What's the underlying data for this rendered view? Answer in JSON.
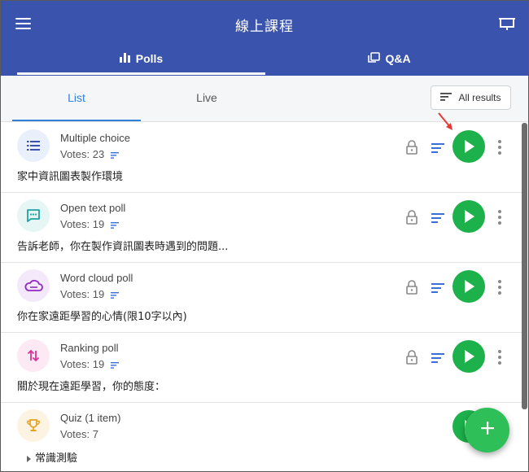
{
  "header": {
    "title": "線上課程",
    "menu_icon": "hamburger-icon",
    "present_icon": "screen-icon"
  },
  "tabs": [
    {
      "label": "Polls",
      "icon": "bar-chart-icon",
      "active": true
    },
    {
      "label": "Q&A",
      "icon": "chat-bubbles-icon",
      "active": false
    }
  ],
  "subtabs": [
    {
      "label": "List",
      "active": true
    },
    {
      "label": "Live",
      "active": false
    }
  ],
  "results_button": {
    "label": "All results",
    "icon": "sort-lines-icon"
  },
  "polls": [
    {
      "type": "Multiple choice",
      "votes": "Votes: 23",
      "question": "家中資訊圖表製作環境",
      "icon": "list-icon",
      "color": "#3a54ad",
      "bg": "#eaf0fb"
    },
    {
      "type": "Open text poll",
      "votes": "Votes: 19",
      "question": "告訴老師，你在製作資訊圖表時遇到的問題...",
      "icon": "message-icon",
      "color": "#1ea3a3",
      "bg": "#e5f6f5"
    },
    {
      "type": "Word cloud poll",
      "votes": "Votes: 19",
      "question": "你在家遠距學習的心情(限10字以內)",
      "icon": "cloud-icon",
      "color": "#9326c4",
      "bg": "#f4e9fa"
    },
    {
      "type": "Ranking poll",
      "votes": "Votes: 19",
      "question": "關於現在遠距學習，你的態度：",
      "icon": "swap-arrows-icon",
      "color": "#d6339a",
      "bg": "#fce9f4"
    },
    {
      "type": "Quiz (1 item)",
      "votes": "Votes: 7",
      "question": "常識測驗",
      "icon": "trophy-icon",
      "color": "#e8a020",
      "bg": "#fdf3e3"
    }
  ],
  "colors": {
    "header": "#3a54ad",
    "accent": "#2f80d9",
    "play": "#1db14b",
    "fab": "#2fbf58",
    "annotation_arrow": "#e53935"
  },
  "fab": {
    "icon": "plus-icon"
  }
}
